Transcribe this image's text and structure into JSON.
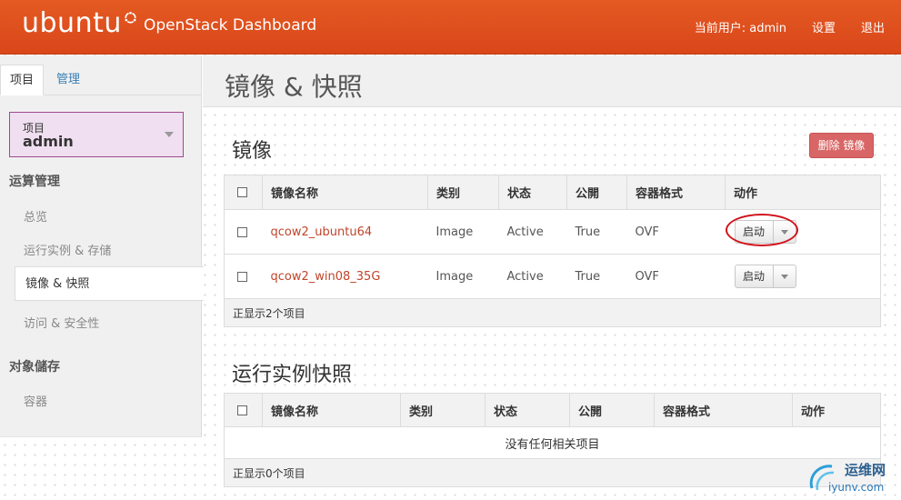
{
  "header": {
    "brand": "ubuntu",
    "dashboard_title": "OpenStack Dashboard",
    "current_user": "当前用户: admin",
    "settings": "设置",
    "logout": "退出",
    "brand_color": "#dd4814"
  },
  "sidebar": {
    "tabs": [
      "项目",
      "管理"
    ],
    "project_label": "项目",
    "project_value": "admin",
    "section_compute": "运算管理",
    "items": [
      "总览",
      "运行实例 & 存储",
      "镜像 & 快照",
      "访问 & 安全性"
    ],
    "section_storage": "对象儲存",
    "storage_items": [
      "容器"
    ]
  },
  "page": {
    "title": "镜像 & 快照"
  },
  "images": {
    "title": "镜像",
    "delete_button": "删除 镜像",
    "columns": [
      "镜像名称",
      "类别",
      "状态",
      "公開",
      "容器格式",
      "动作"
    ],
    "rows": [
      {
        "name": "qcow2_ubuntu64",
        "type": "Image",
        "status": "Active",
        "public": "True",
        "format": "OVF",
        "action": "启动"
      },
      {
        "name": "qcow2_win08_35G",
        "type": "Image",
        "status": "Active",
        "public": "True",
        "format": "OVF",
        "action": "启动"
      }
    ],
    "footer": "正显示2个项目"
  },
  "snapshots": {
    "title": "运行实例快照",
    "columns": [
      "镜像名称",
      "类别",
      "状态",
      "公開",
      "容器格式",
      "动作"
    ],
    "empty": "没有任何相关项目",
    "footer": "正显示0个项目"
  },
  "watermark": {
    "line1": "运维网",
    "line2": "iyunv.com"
  }
}
